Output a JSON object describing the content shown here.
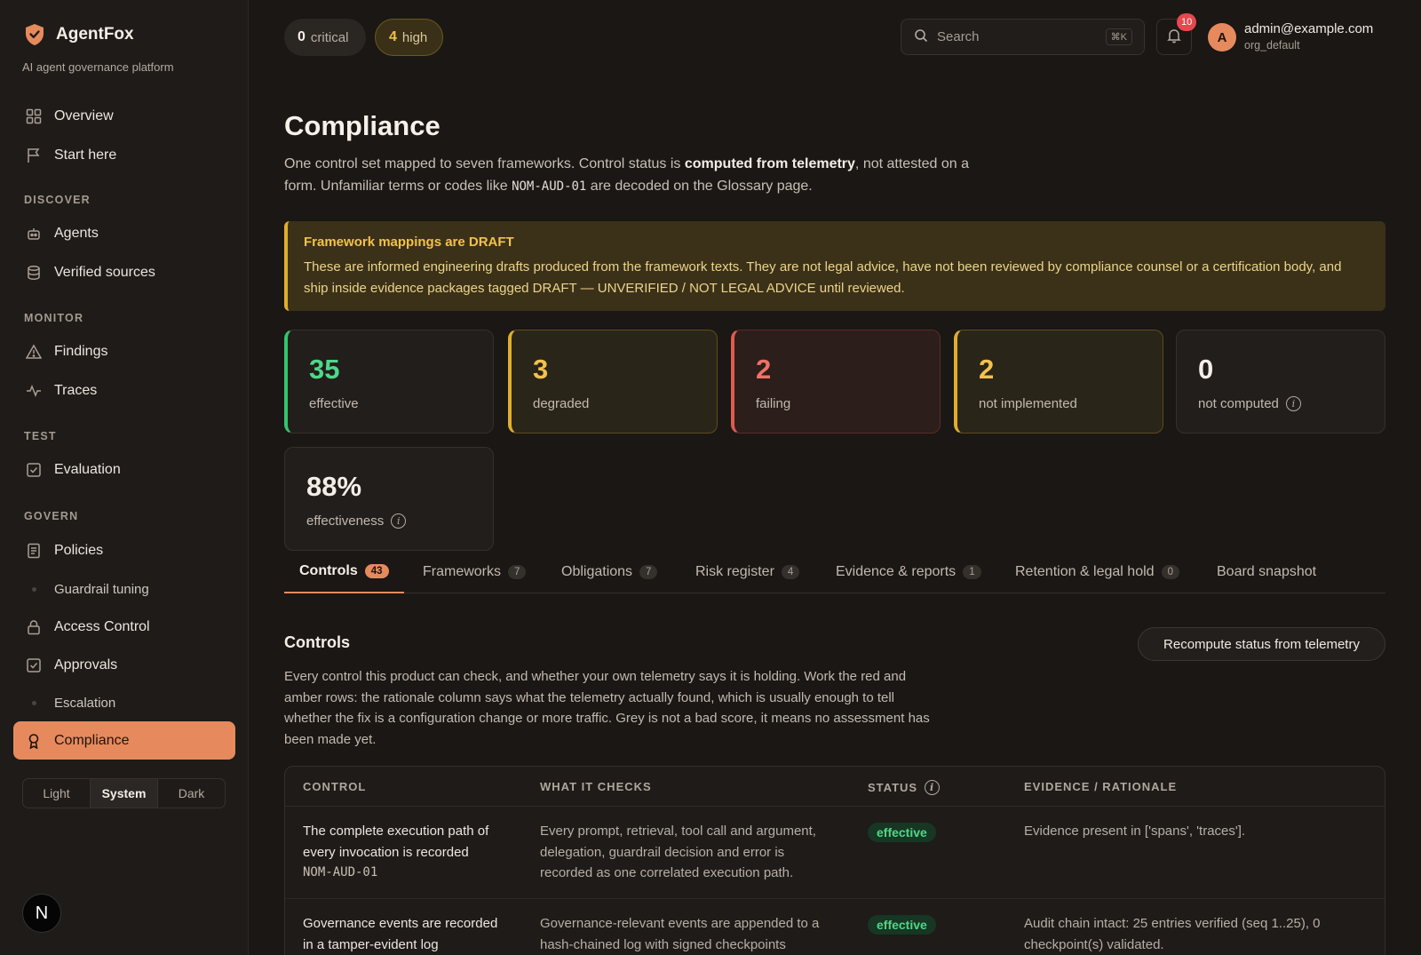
{
  "brand": {
    "name": "AgentFox",
    "tagline": "AI agent governance platform",
    "accent_color": "#e68a5e"
  },
  "sidebar": {
    "top_items": [
      {
        "label": "Overview",
        "icon": "grid-icon"
      },
      {
        "label": "Start here",
        "icon": "flag-icon"
      }
    ],
    "sections": [
      {
        "title": "DISCOVER",
        "items": [
          {
            "label": "Agents",
            "icon": "robot-icon"
          },
          {
            "label": "Verified sources",
            "icon": "database-icon"
          }
        ]
      },
      {
        "title": "MONITOR",
        "items": [
          {
            "label": "Findings",
            "icon": "warning-icon"
          },
          {
            "label": "Traces",
            "icon": "activity-icon"
          }
        ]
      },
      {
        "title": "TEST",
        "items": [
          {
            "label": "Evaluation",
            "icon": "check-square-icon"
          }
        ]
      },
      {
        "title": "GOVERN",
        "items": [
          {
            "label": "Policies",
            "icon": "document-icon"
          },
          {
            "label": "Guardrail tuning",
            "sub": true
          },
          {
            "label": "Access Control",
            "icon": "lock-icon"
          },
          {
            "label": "Approvals",
            "icon": "check-square-icon"
          },
          {
            "label": "Escalation",
            "sub": true
          },
          {
            "label": "Compliance",
            "icon": "award-icon",
            "active": true
          }
        ]
      }
    ],
    "theme": {
      "options": [
        "Light",
        "System",
        "Dark"
      ],
      "selected": "System"
    },
    "bottom_badge": "N"
  },
  "topbar": {
    "critical": {
      "count": "0",
      "label": "critical"
    },
    "high": {
      "count": "4",
      "label": "high"
    },
    "search_placeholder": "Search",
    "search_shortcut": "⌘K",
    "notifications": "10",
    "user": {
      "initial": "A",
      "email": "admin@example.com",
      "org": "org_default"
    }
  },
  "page": {
    "title": "Compliance",
    "desc_part1": "One control set mapped to seven frameworks. Control status is ",
    "desc_bold": "computed from telemetry",
    "desc_part2": ", not attested on a form. Unfamiliar terms or codes like ",
    "desc_code": "NOM-AUD-01",
    "desc_part3": " are decoded on the Glossary page."
  },
  "draft_notice": {
    "title": "Framework mappings are DRAFT",
    "body": "These are informed engineering drafts produced from the framework texts. They are not legal advice, have not been reviewed by compliance counsel or a certification body, and ship inside evidence packages tagged DRAFT — UNVERIFIED / NOT LEGAL ADVICE until reviewed."
  },
  "stats": [
    {
      "value": "35",
      "label": "effective",
      "tone": "green"
    },
    {
      "value": "3",
      "label": "degraded",
      "tone": "amber"
    },
    {
      "value": "2",
      "label": "failing",
      "tone": "red"
    },
    {
      "value": "2",
      "label": "not implemented",
      "tone": "amber"
    },
    {
      "value": "0",
      "label": "not computed",
      "tone": "neutral"
    },
    {
      "value": "88%",
      "label": "effectiveness",
      "tone": "neutral"
    }
  ],
  "tabs": [
    {
      "label": "Controls",
      "count": "43",
      "active": true
    },
    {
      "label": "Frameworks",
      "count": "7"
    },
    {
      "label": "Obligations",
      "count": "7"
    },
    {
      "label": "Risk register",
      "count": "4"
    },
    {
      "label": "Evidence & reports",
      "count": "1"
    },
    {
      "label": "Retention & legal hold",
      "count": "0"
    },
    {
      "label": "Board snapshot",
      "count": ""
    }
  ],
  "controls": {
    "title": "Controls",
    "recompute_label": "Recompute status from telemetry",
    "description": "Every control this product can check, and whether your own telemetry says it is holding. Work the red and amber rows: the rationale column says what the telemetry actually found, which is usually enough to tell whether the fix is a configuration change or more traffic. Grey is not a bad score, it means no assessment has been made yet.",
    "columns": [
      "CONTROL",
      "WHAT IT CHECKS",
      "STATUS",
      "EVIDENCE / RATIONALE"
    ],
    "rows": [
      {
        "control": "The complete execution path of every invocation is recorded",
        "code": "NOM-AUD-01",
        "checks": "Every prompt, retrieval, tool call and argument, delegation, guardrail decision and error is recorded as one correlated execution path.",
        "status": "effective",
        "evidence": "Evidence present in ['spans', 'traces']."
      },
      {
        "control": "Governance events are recorded in a tamper-evident log",
        "code": "",
        "checks": "Governance-relevant events are appended to a hash-chained log with signed checkpoints",
        "status": "effective",
        "evidence": "Audit chain intact: 25 entries verified (seq 1..25), 0 checkpoint(s) validated."
      }
    ]
  }
}
